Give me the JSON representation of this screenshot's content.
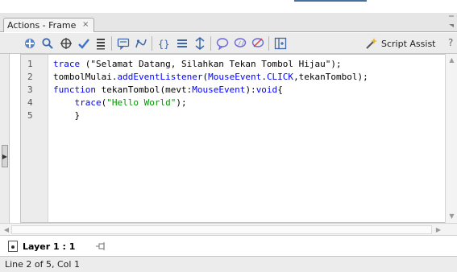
{
  "panel": {
    "tab_title": "Actions - Frame",
    "tab_close": "×"
  },
  "toolbar": {
    "buttons": [
      {
        "icon": "add-statement-icon"
      },
      {
        "icon": "find-icon"
      },
      {
        "icon": "insert-target-path-icon"
      },
      {
        "icon": "check-syntax-icon"
      },
      {
        "icon": "auto-format-icon"
      },
      {
        "icon": "show-code-hint-icon"
      },
      {
        "icon": "debug-options-icon"
      },
      {
        "icon": "collapse-between-braces-icon"
      },
      {
        "icon": "collapse-selection-icon"
      },
      {
        "icon": "expand-all-icon"
      },
      {
        "icon": "apply-block-comment-icon"
      },
      {
        "icon": "apply-line-comment-icon"
      },
      {
        "icon": "remove-comment-icon"
      },
      {
        "icon": "show-hide-toolbox-icon"
      }
    ],
    "script_assist_label": "Script Assist",
    "help_glyph": "?"
  },
  "editor": {
    "line_numbers": [
      "1",
      "2",
      "3",
      "4",
      "5"
    ],
    "lines": [
      [
        {
          "t": "trace",
          "c": "kw"
        },
        {
          "t": " (\"Selamat Datang, Silahkan Tekan Tombol Hijau\");",
          "c": "plain"
        }
      ],
      [
        {
          "t": "tombolMulai.",
          "c": "plain"
        },
        {
          "t": "addEventListener",
          "c": "kw"
        },
        {
          "t": "(",
          "c": "plain"
        },
        {
          "t": "MouseEvent",
          "c": "kw"
        },
        {
          "t": ".",
          "c": "plain"
        },
        {
          "t": "CLICK",
          "c": "kw"
        },
        {
          "t": ",tekanTombol);",
          "c": "plain"
        }
      ],
      [
        {
          "t": "function",
          "c": "kw"
        },
        {
          "t": " tekanTombol(mevt:",
          "c": "plain"
        },
        {
          "t": "MouseEvent",
          "c": "kw"
        },
        {
          "t": "):",
          "c": "plain"
        },
        {
          "t": "void",
          "c": "kw"
        },
        {
          "t": "{",
          "c": "plain"
        }
      ],
      [
        {
          "t": "    ",
          "c": "plain"
        },
        {
          "t": "trace",
          "c": "kw"
        },
        {
          "t": "(",
          "c": "plain"
        },
        {
          "t": "\"Hello World\"",
          "c": "str"
        },
        {
          "t": ");",
          "c": "plain"
        }
      ],
      [
        {
          "t": "    }",
          "c": "plain"
        }
      ]
    ]
  },
  "layer": {
    "label": "Layer 1 : 1"
  },
  "status": {
    "text": "Line 2 of 5, Col 1"
  },
  "colors": {
    "keyword": "#0000ff",
    "string": "#009900",
    "accent": "#4a6e9e"
  }
}
